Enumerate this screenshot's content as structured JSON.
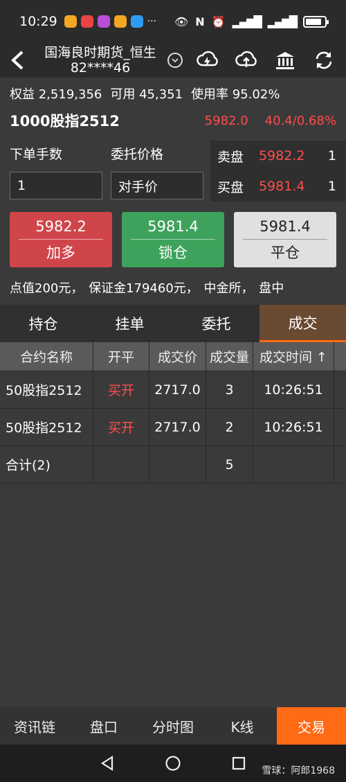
{
  "status": {
    "time": "10:29",
    "extra": "···"
  },
  "header": {
    "title_line1": "国海良时期货_恒生",
    "title_line2": "82****46"
  },
  "account": {
    "equity_label": "权益",
    "equity_value": "2,519,356",
    "available_label": "可用",
    "available_value": "45,351",
    "usage_label": "使用率",
    "usage_value": "95.02%"
  },
  "contract": {
    "name": "1000股指2512",
    "last_price": "5982.0",
    "change": "40.4/0.68%"
  },
  "order_form": {
    "qty_label": "下单手数",
    "price_label": "委托价格",
    "qty_value": "1",
    "price_value": "对手价"
  },
  "orderbook": {
    "ask_label": "卖盘",
    "ask_price": "5982.2",
    "ask_vol": "1",
    "bid_label": "买盘",
    "bid_price": "5981.4",
    "bid_vol": "1"
  },
  "buttons": {
    "long_price": "5982.2",
    "long_label": "加多",
    "lock_price": "5981.4",
    "lock_label": "锁仓",
    "close_price": "5981.4",
    "close_label": "平仓"
  },
  "info_line": "点值200元， 保证金179460元， 中金所， 盘中",
  "tabs": [
    "持仓",
    "挂单",
    "委托",
    "成交"
  ],
  "table": {
    "headers": [
      "合约名称",
      "开平",
      "成交价",
      "成交量",
      "成交时间 ↑"
    ],
    "rows": [
      [
        "50股指2512",
        "买开",
        "2717.0",
        "3",
        "10:26:51"
      ],
      [
        "50股指2512",
        "买开",
        "2717.0",
        "2",
        "10:26:51"
      ]
    ],
    "total": [
      "合计(2)",
      "",
      "",
      "5",
      ""
    ]
  },
  "bottom_nav": [
    "资讯链",
    "盘口",
    "分时图",
    "K线",
    "交易"
  ],
  "watermark": "雪球：阿郎1968",
  "colors": {
    "up_red": "#ff4d4d",
    "accent_orange": "#ff6a14",
    "lock_green": "#3ea25c",
    "long_red": "#d0454a"
  }
}
